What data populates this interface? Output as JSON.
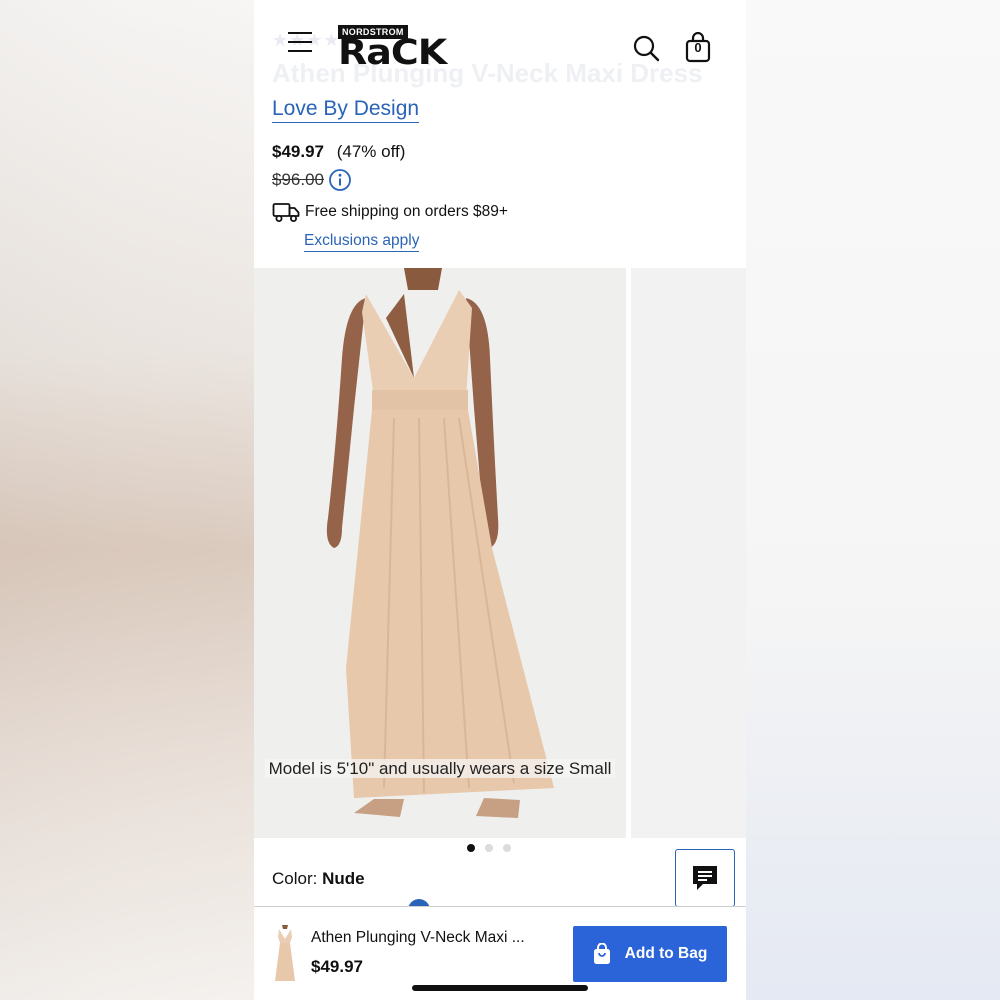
{
  "header": {
    "logo_top": "NORDSTROM",
    "logo_main": "RaCK",
    "ghost_stars": "★★★★",
    "ghost_title": "Athen Plunging V-Neck Maxi Dress",
    "bag_count": "0",
    "icons": {
      "menu": "hamburger-icon",
      "search": "search-icon",
      "bag": "shopping-bag-icon"
    }
  },
  "product": {
    "brand": "Love By Design",
    "price": "$49.97",
    "discount": "(47% off)",
    "original_price": "$96.00",
    "shipping": "Free shipping on orders $89+",
    "exclusions": "Exclusions apply",
    "model_info": "Model is 5'10\" and usually wears a size Small",
    "color_label": "Color:",
    "color_value": "Nude"
  },
  "gallery": {
    "slides": 3,
    "active": 1,
    "dress_color": "#e6c9ae"
  },
  "footer": {
    "name": "Athen Plunging V-Neck Maxi ...",
    "price": "$49.97",
    "add_label": "Add to Bag"
  },
  "colors": {
    "accent": "#2a64b8",
    "button": "#2a64d8",
    "text": "#111111"
  }
}
